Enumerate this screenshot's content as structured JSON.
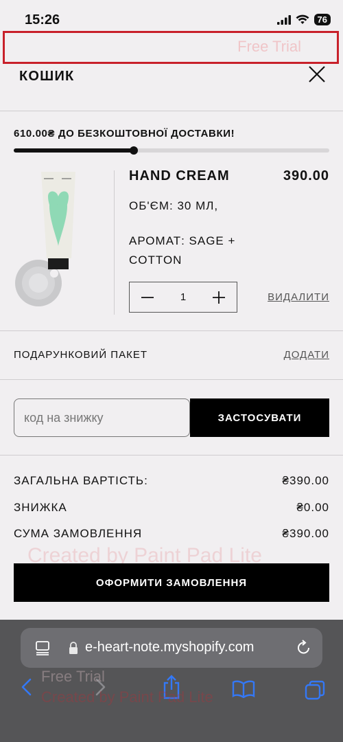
{
  "status_bar": {
    "time": "15:26",
    "battery": "76"
  },
  "watermark": {
    "top_text": "Free Trial",
    "mid_text": "Created by Paint Pad Lite",
    "bottom_text": "Free Trial",
    "bottom_text2": "Created by Paint Pad Lite"
  },
  "cart": {
    "title": "КОШИК",
    "shipping_message": "610.00₴ ДО БЕЗКОШТОВНОЇ ДОСТАВКИ!",
    "shipping_progress": 0.38,
    "product": {
      "name": "HAND CREAM",
      "price": "390.00",
      "volume": "ОБ'ЄМ: 30 МЛ,",
      "scent": "АРОМАТ: SAGE + COTTON",
      "quantity": "1",
      "remove_label": "ВИДАЛИТИ",
      "image_icon": "hand-cream-tube"
    },
    "gift": {
      "label": "ПОДАРУНКОВИЙ ПАКЕТ",
      "add_label": "ДОДАТИ"
    },
    "promo": {
      "placeholder": "код на знижку",
      "value": "",
      "apply_label": "ЗАСТОСУВАТИ"
    },
    "summary": [
      {
        "label": "ЗАГАЛЬНА ВАРТІСТЬ:",
        "value": "₴390.00"
      },
      {
        "label": "ЗНИЖКА",
        "value": "₴0.00"
      },
      {
        "label": "СУМА ЗАМОВЛЕННЯ",
        "value": "₴390.00"
      }
    ],
    "checkout_label": "ОФОРМИТИ ЗАМОВЛЕННЯ"
  },
  "browser": {
    "url": "e-heart-note.myshopify.com"
  },
  "colors": {
    "accent_red": "#c8202a",
    "ios_blue": "#3478f6",
    "tube_green": "#8fd9b5"
  }
}
